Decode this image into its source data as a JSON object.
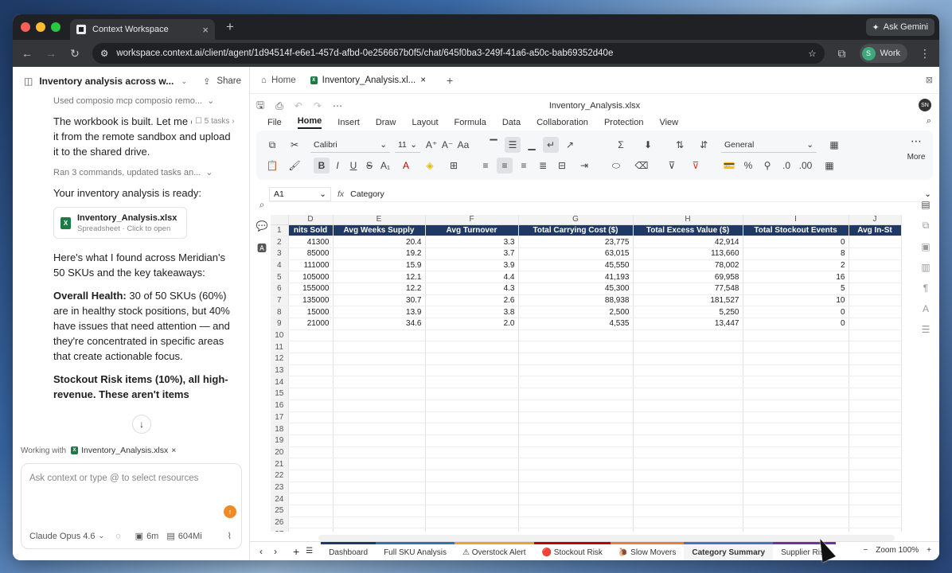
{
  "browser": {
    "tab_title": "Context Workspace",
    "ask_gemini": "Ask Gemini",
    "url": "workspace.context.ai/client/agent/1d94514f-e6e1-457d-afbd-0e256667b0f5/chat/645f0ba3-249f-41a6-a50c-bab69352d40e",
    "profile_initial": "S",
    "profile_label": "Work"
  },
  "chat": {
    "title": "Inventory analysis across w...",
    "share_label": "Share",
    "top_muted": "Used composio mcp composio remo...",
    "msg1": "The workbook is built. Let me download it from the remote sandbox and upload it to the shared drive.",
    "tasks_label": "5 tasks",
    "ran_muted": "Ran 3 commands, updated tasks an...",
    "ready_text": "Your inventory analysis is ready:",
    "file_name": "Inventory_Analysis.xlsx",
    "file_sub": "Spreadsheet · Click to open",
    "found_text": "Here's what I found across Meridian's 50 SKUs and the key takeaways:",
    "health_label": "Overall Health:",
    "health_text": " 30 of 50 SKUs (60%) are in healthy stock positions, but 40% have issues that need attention — and they're concentrated in specific areas that create actionable focus.",
    "stockout_label": "Stockout Risk",
    "stockout_text": " items (10%), all high-revenue. These aren't items",
    "working_with": "Working with",
    "working_file": "Inventory_Analysis.xlsx",
    "composer_placeholder": "Ask context or type @ to select resources",
    "model": "Claude Opus 4.6",
    "time": "6m",
    "mem": "604Mi"
  },
  "workspace": {
    "tabs": [
      {
        "label": "Home"
      },
      {
        "label": "Inventory_Analysis.xl..."
      }
    ],
    "file_title": "Inventory_Analysis.xlsx",
    "avatar": "SN",
    "menu": [
      "File",
      "Home",
      "Insert",
      "Draw",
      "Layout",
      "Formula",
      "Data",
      "Collaboration",
      "Protection",
      "View"
    ],
    "font": "Calibri",
    "font_size": "11",
    "number_format": "General",
    "more_label": "More",
    "cell_ref": "A1",
    "cell_value": "Category"
  },
  "sheet": {
    "columns": [
      "D",
      "E",
      "F",
      "G",
      "H",
      "I",
      "J"
    ],
    "headers": [
      "nits Sold",
      "Avg Weeks Supply",
      "Avg Turnover",
      "Total Carrying Cost ($)",
      "Total Excess Value ($)",
      "Total Stockout Events",
      "Avg In-St"
    ],
    "rows": [
      [
        "41300",
        "20.4",
        "3.3",
        "23,775",
        "42,914",
        "0",
        ""
      ],
      [
        "85000",
        "19.2",
        "3.7",
        "63,015",
        "113,660",
        "8",
        ""
      ],
      [
        "111000",
        "15.9",
        "3.9",
        "45,550",
        "78,002",
        "2",
        ""
      ],
      [
        "105000",
        "12.1",
        "4.4",
        "41,193",
        "69,958",
        "16",
        ""
      ],
      [
        "155000",
        "12.2",
        "4.3",
        "45,300",
        "77,548",
        "5",
        ""
      ],
      [
        "135000",
        "30.7",
        "2.6",
        "88,938",
        "181,527",
        "10",
        ""
      ],
      [
        "15000",
        "13.9",
        "3.8",
        "2,500",
        "5,250",
        "0",
        ""
      ],
      [
        "21000",
        "34.6",
        "2.0",
        "4,535",
        "13,447",
        "0",
        ""
      ]
    ],
    "total_rows": 27,
    "sheet_tabs": [
      {
        "label": "Dashboard",
        "color": "#1f3864"
      },
      {
        "label": "Full SKU Analysis",
        "color": "#2e75b6"
      },
      {
        "label": "⚠ Overstock Alert",
        "color": "#f0a030"
      },
      {
        "label": "🔴 Stockout Risk",
        "color": "#c00000"
      },
      {
        "label": "🐌 Slow Movers",
        "color": "#ed7d31"
      },
      {
        "label": "Category Summary",
        "color": "#4472c4"
      },
      {
        "label": "Supplier Risk",
        "color": "#7030a0"
      }
    ],
    "zoom": "Zoom 100%"
  }
}
